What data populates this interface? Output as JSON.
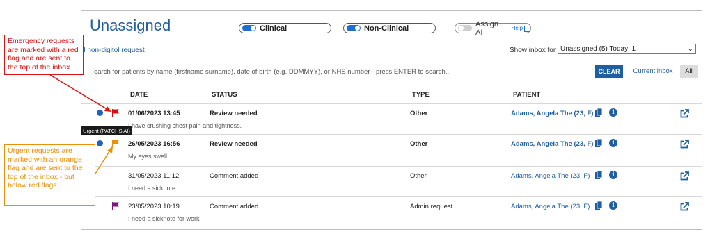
{
  "header": {
    "title": "Unassigned",
    "toggles": [
      {
        "label": "Clinical",
        "on": true
      },
      {
        "label": "Non-Clinical",
        "on": true
      },
      {
        "label": "Assign AI",
        "on": false,
        "help": "Help"
      }
    ],
    "non_digital_link": "d non-digitol request",
    "show_inbox_label": "Show inbox for",
    "inbox_select": "Unassigned (5) Today: 1"
  },
  "search": {
    "placeholder": "earch for patients by name (firstname surname), date of birth (e.g. DDMMYY), or NHS number - press ENTER to search...",
    "clear": "CLEAR",
    "current_inbox": "Current inbox",
    "all": "All"
  },
  "columns": {
    "date": "DATE",
    "status": "STATUS",
    "type": "TYPE",
    "patient": "PATIENT"
  },
  "rows": [
    {
      "flag": "red",
      "unread": true,
      "date": "01/06/2023 13:45",
      "status": "Review needed",
      "type": "Other",
      "patient": "Adams, Angela The (23, F)",
      "message": "I have crushing chest pain and tightness."
    },
    {
      "flag": "orange",
      "unread": true,
      "date": "26/05/2023 16:56",
      "status": "Review needed",
      "type": "Other",
      "patient": "Adams, Angela The (23, F)",
      "message": "My eyes swell"
    },
    {
      "flag": "none",
      "unread": false,
      "date": "31/05/2023 11:12",
      "status": "Comment added",
      "type": "Other",
      "patient": "Adams, Angela The (23, F)",
      "message": "I need a sicknote"
    },
    {
      "flag": "purple",
      "unread": false,
      "date": "23/05/2023 10:19",
      "status": "Comment added",
      "type": "Admin request",
      "patient": "Adams, Angela The (23, F)",
      "message": "I need a sicknote for work"
    }
  ],
  "tooltip": "Urgent (PATCHS AI)",
  "annotations": {
    "red": "Emergency requests are marked with a red flag and are sent to the top of the inbox",
    "orange": "Urgent requests are marked with an orange flag and are sent to the top of the inbox - but below red flags"
  },
  "colors": {
    "accent": "#1f5fa0",
    "red_flag": "#d11111",
    "orange_flag": "#e8900f",
    "purple_flag": "#7b1a7b"
  }
}
